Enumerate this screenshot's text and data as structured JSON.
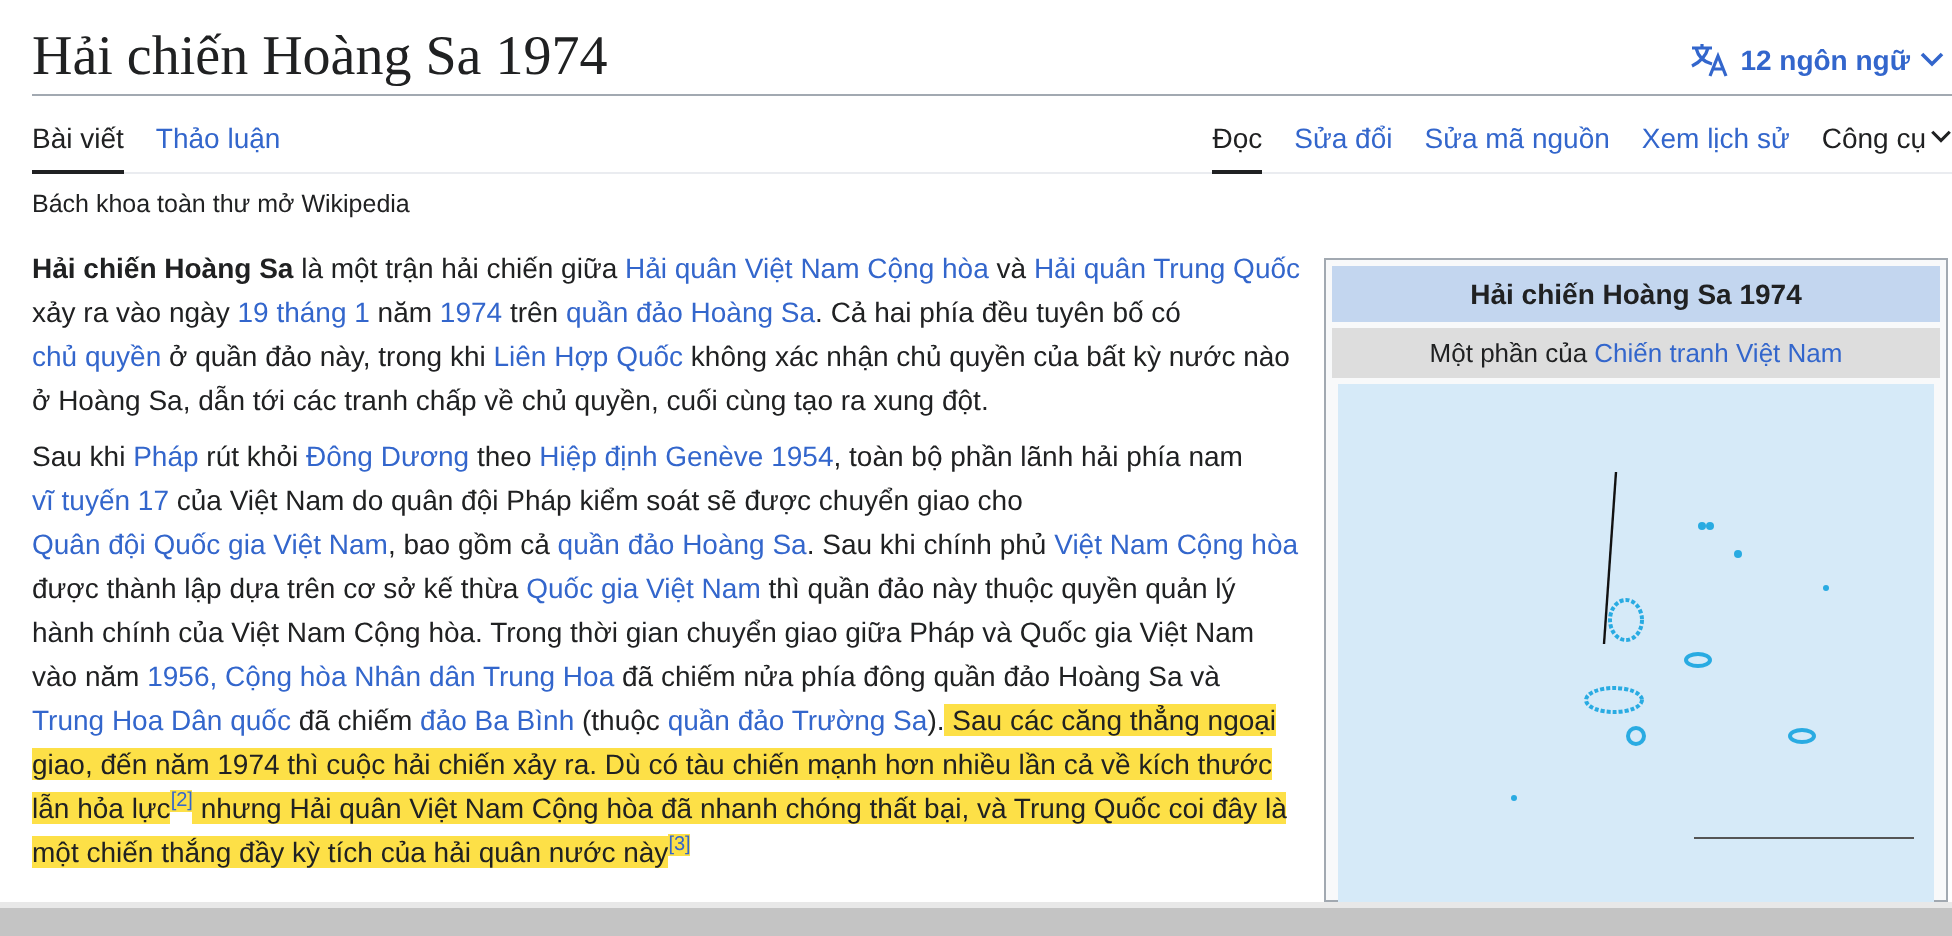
{
  "title": "Hải chiến Hoàng Sa 1974",
  "language_button": {
    "label": "12 ngôn ngữ"
  },
  "tabs_left": [
    {
      "label": "Bài viết",
      "selected": true
    },
    {
      "label": "Thảo luận",
      "selected": false
    }
  ],
  "tabs_right": [
    {
      "label": "Đọc",
      "selected": true
    },
    {
      "label": "Sửa đổi",
      "selected": false
    },
    {
      "label": "Sửa mã nguồn",
      "selected": false
    },
    {
      "label": "Xem lịch sử",
      "selected": false
    }
  ],
  "tools_menu": {
    "label": "Công cụ"
  },
  "tagline": "Bách khoa toàn thư mở Wikipedia",
  "paragraphs": [
    [
      {
        "kind": "bold",
        "text": "Hải chiến Hoàng Sa",
        "highlighted": false
      },
      {
        "kind": "text",
        "text": " là một trận hải chiến giữa ",
        "highlighted": false
      },
      {
        "kind": "link",
        "text": "Hải quân Việt Nam Cộng hòa",
        "highlighted": false
      },
      {
        "kind": "text",
        "text": " và ",
        "highlighted": false
      },
      {
        "kind": "link",
        "text": "Hải quân Trung Quốc",
        "highlighted": false
      },
      {
        "kind": "text",
        "text": " xảy ra vào ngày ",
        "highlighted": false
      },
      {
        "kind": "link",
        "text": "19 tháng 1",
        "highlighted": false
      },
      {
        "kind": "text",
        "text": " năm ",
        "highlighted": false
      },
      {
        "kind": "link",
        "text": "1974",
        "highlighted": false
      },
      {
        "kind": "text",
        "text": " trên ",
        "highlighted": false
      },
      {
        "kind": "link",
        "text": "quần đảo Hoàng Sa",
        "highlighted": false
      },
      {
        "kind": "text",
        "text": ". Cả hai phía đều tuyên bố có ",
        "highlighted": false
      },
      {
        "kind": "link",
        "text": "chủ quyền",
        "highlighted": false
      },
      {
        "kind": "text",
        "text": " ở quần đảo này, trong khi ",
        "highlighted": false
      },
      {
        "kind": "link",
        "text": "Liên Hợp Quốc",
        "highlighted": false
      },
      {
        "kind": "text",
        "text": " không xác nhận chủ quyền của bất kỳ nước nào ở Hoàng Sa, dẫn tới các tranh chấp về chủ quyền, cuối cùng tạo ra xung đột.",
        "highlighted": false
      }
    ],
    [
      {
        "kind": "text",
        "text": "Sau khi ",
        "highlighted": false
      },
      {
        "kind": "link",
        "text": "Pháp",
        "highlighted": false
      },
      {
        "kind": "text",
        "text": " rút khỏi ",
        "highlighted": false
      },
      {
        "kind": "link",
        "text": "Đông Dương",
        "highlighted": false
      },
      {
        "kind": "text",
        "text": " theo ",
        "highlighted": false
      },
      {
        "kind": "link",
        "text": "Hiệp định Genève 1954",
        "highlighted": false
      },
      {
        "kind": "text",
        "text": ", toàn bộ phần lãnh hải phía nam ",
        "highlighted": false
      },
      {
        "kind": "link",
        "text": "vĩ tuyến 17",
        "highlighted": false
      },
      {
        "kind": "text",
        "text": " của Việt Nam do quân đội Pháp kiểm soát sẽ được chuyển giao cho ",
        "highlighted": false
      },
      {
        "kind": "link",
        "text": "Quân đội Quốc gia Việt Nam",
        "highlighted": false
      },
      {
        "kind": "text",
        "text": ", bao gồm cả ",
        "highlighted": false
      },
      {
        "kind": "link",
        "text": "quần đảo Hoàng Sa",
        "highlighted": false
      },
      {
        "kind": "text",
        "text": ". Sau khi chính phủ ",
        "highlighted": false
      },
      {
        "kind": "link",
        "text": "Việt Nam Cộng hòa",
        "highlighted": false
      },
      {
        "kind": "text",
        "text": " được thành lập dựa trên cơ sở kế thừa ",
        "highlighted": false
      },
      {
        "kind": "link",
        "text": "Quốc gia Việt Nam",
        "highlighted": false
      },
      {
        "kind": "text",
        "text": " thì quần đảo này thuộc quyền quản lý hành chính của Việt Nam Cộng hòa. Trong thời gian chuyển giao giữa Pháp và Quốc gia Việt Nam vào năm ",
        "highlighted": false
      },
      {
        "kind": "link",
        "text": "1956, Cộng hòa Nhân dân Trung Hoa",
        "highlighted": false
      },
      {
        "kind": "text",
        "text": " đã chiếm nửa phía đông quần đảo Hoàng Sa và ",
        "highlighted": false
      },
      {
        "kind": "link",
        "text": "Trung Hoa Dân quốc",
        "highlighted": false
      },
      {
        "kind": "text",
        "text": " đã chiếm ",
        "highlighted": false
      },
      {
        "kind": "link",
        "text": "đảo Ba Bình",
        "highlighted": false
      },
      {
        "kind": "text",
        "text": " (thuộc ",
        "highlighted": false
      },
      {
        "kind": "link",
        "text": "quần đảo Trường Sa",
        "highlighted": false
      },
      {
        "kind": "text",
        "text": ").",
        "highlighted": false
      },
      {
        "kind": "text",
        "text": " Sau các căng thẳng ngoại giao, đến năm 1974 thì cuộc hải chiến xảy ra. Dù có tàu chiến mạnh hơn nhiều lần cả về kích thước lẫn hỏa lực",
        "highlighted": true
      },
      {
        "kind": "ref",
        "text": "[2]",
        "highlighted": true
      },
      {
        "kind": "text",
        "text": " nhưng Hải quân Việt Nam Cộng hòa đã nhanh chóng thất bại, và Trung Quốc coi đây là một chiến thắng đầy kỳ tích của hải quân nước này",
        "highlighted": true
      },
      {
        "kind": "ref",
        "text": "[3]",
        "highlighted": true
      }
    ]
  ],
  "infobox": {
    "title": "Hải chiến Hoàng Sa 1974",
    "subtitle": {
      "prefix": "Một phần của ",
      "link": "Chiến tranh Việt Nam"
    }
  }
}
